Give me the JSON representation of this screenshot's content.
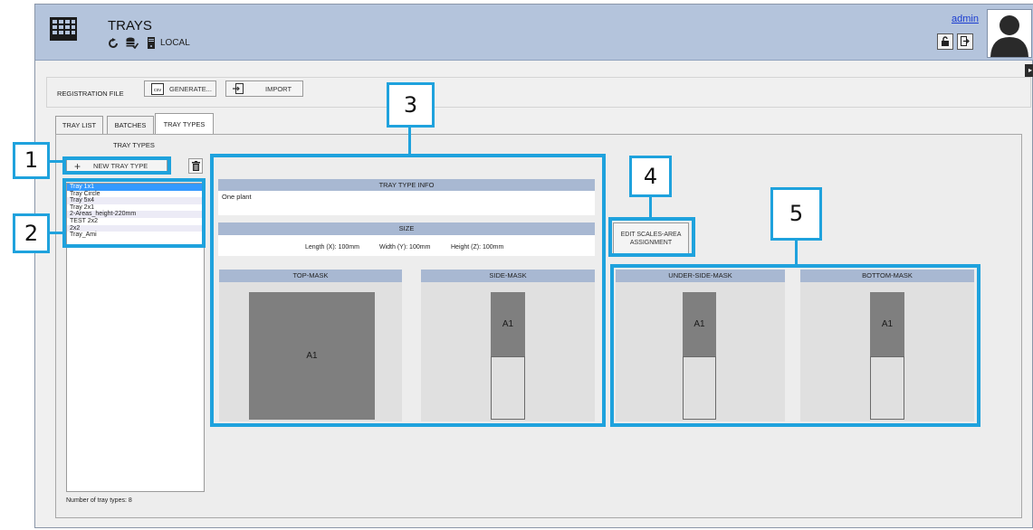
{
  "header": {
    "title": "TRAYS",
    "mode": "LOCAL",
    "user": "admin",
    "icons": [
      "tray-grid-icon",
      "refresh-icon",
      "database-check-icon",
      "server-icon",
      "unlock-icon",
      "logout-icon",
      "user-avatar-icon"
    ]
  },
  "registration": {
    "label": "REGISTRATION FILE",
    "generate_label": "GENERATE...",
    "import_label": "IMPORT",
    "csv_icon_text": "csv"
  },
  "tabs": [
    {
      "label": "TRAY LIST",
      "active": false
    },
    {
      "label": "BATCHES",
      "active": false
    },
    {
      "label": "TRAY TYPES",
      "active": true
    }
  ],
  "tray_types": {
    "heading": "TRAY TYPES",
    "new_button_label": "NEW TRAY TYPE",
    "items": [
      "Tray 1x1",
      "Tray Circle",
      "Tray 5x4",
      "Tray 2x1",
      "2-Areas_height-220mm",
      "TEST 2x2",
      "2x2",
      "Tray_Ami"
    ],
    "selected_index": 0,
    "count_text": "Number of tray types: 8"
  },
  "info": {
    "header": "TRAY TYPE INFO",
    "text": "One plant",
    "size_header": "SIZE",
    "length": "Length (X): 100mm",
    "width": "Width (Y): 100mm",
    "height": "Height (Z): 100mm"
  },
  "edit_scales_label_1": "EDIT SCALES-AREA",
  "edit_scales_label_2": "ASSIGNMENT",
  "masks": {
    "top": {
      "header": "TOP-MASK",
      "area": "A1"
    },
    "side": {
      "header": "SIDE-MASK",
      "area": "A1"
    },
    "underside": {
      "header": "UNDER-SIDE-MASK",
      "area": "A1"
    },
    "bottom": {
      "header": "BOTTOM-MASK",
      "area": "A1"
    }
  },
  "callouts": [
    "1",
    "2",
    "3",
    "4",
    "5"
  ],
  "colors": {
    "header_bg": "#b4c4dc",
    "section_header": "#a8b8d2",
    "selection": "#3399ff",
    "callout": "#1fa2dd",
    "mask_dark": "#7f7f7f"
  }
}
